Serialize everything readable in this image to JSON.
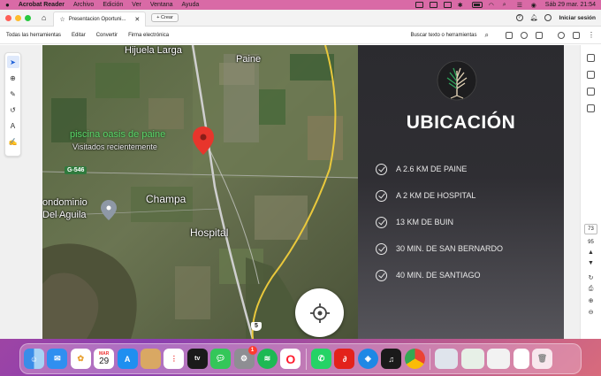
{
  "menubar": {
    "app_name": "Acrobat Reader",
    "items": [
      "Archivo",
      "Edición",
      "Ver",
      "Ventana",
      "Ayuda"
    ],
    "datetime": "Sáb 29 mar.  21:54"
  },
  "tabbar": {
    "doc_tab_title": "Presentacion Oportuni...",
    "create_label": "Crear",
    "sign_in": "Iniciar sesión"
  },
  "toolbar": {
    "items": [
      "Todas las herramientas",
      "Editar",
      "Convertir",
      "Firma electrónica"
    ],
    "search_label": "Buscar texto o herramientas"
  },
  "map": {
    "labels": {
      "hijuela": "Hijuela Larga",
      "paine": "Paine",
      "piscina": "piscina oasis de paine",
      "visitados": "Visitados recientemente",
      "road": "G-546",
      "champa": "Champa",
      "condominio_1": "ondominio",
      "condominio_2": "Del Aguila",
      "hospital": "Hospital",
      "route": "5"
    }
  },
  "panel": {
    "title": "UBICACIÓN",
    "items": [
      "A 2.6 KM DE PAINE",
      "A 2 KM DE HOSPITAL",
      "13 KM DE BUIN",
      "30 MIN. DE SAN BERNARDO",
      "40 MIN. DE SANTIAGO"
    ]
  },
  "rightrail": {
    "page_current": "73",
    "page_total": "95"
  },
  "dock": {
    "calendar_month": "MAR",
    "calendar_day": "29",
    "settings_badge": "1",
    "tv_label": "tv",
    "icons": [
      "finder-icon",
      "mail-icon",
      "photos-icon",
      "calendar-icon",
      "appstore-icon",
      "notes-icon",
      "reminders-icon",
      "tv-icon",
      "messages-icon",
      "settings-icon",
      "spotify-icon",
      "opera-icon",
      "whatsapp-icon",
      "acrobat-icon",
      "safari-icon",
      "voicememos-icon",
      "chrome-icon",
      "window-1-icon",
      "window-2-icon",
      "window-3-icon",
      "window-4-icon",
      "trash-icon"
    ]
  }
}
